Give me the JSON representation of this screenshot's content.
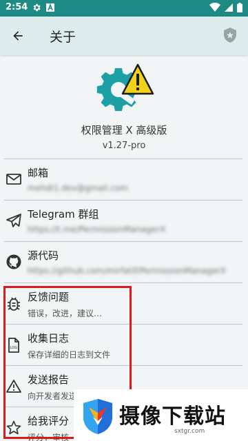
{
  "status_bar": {
    "time": "2:54"
  },
  "app_bar": {
    "title": "关于"
  },
  "header": {
    "app_name": "权限管理 X 高级版",
    "version": "v1.27-pro"
  },
  "items": [
    {
      "title": "邮箱",
      "subtitle": "mehdi1.dev@gmail.com",
      "icon": "mail-icon"
    },
    {
      "title": "Telegram 群组",
      "subtitle": "https://t.me/PermissionManagerX",
      "icon": "telegram-icon"
    },
    {
      "title": "源代码",
      "subtitle": "https://github.com/mirfatif/PermissionManagerX",
      "icon": "github-icon"
    },
    {
      "title": "反馈问题",
      "subtitle": "错误，改进，建议…",
      "icon": "bug-icon"
    },
    {
      "title": "收集日志",
      "subtitle": "保存详细的日志到文件",
      "icon": "log-file-icon"
    },
    {
      "title": "发送报告",
      "subtitle": "向开发者发送崩溃日志",
      "icon": "warning-icon"
    },
    {
      "title": "给我评分",
      "subtitle": "评分，审核",
      "icon": "star-icon"
    }
  ],
  "watermark": {
    "title": "摄像下载站",
    "url": "sxtgr.com"
  },
  "colors": {
    "status_bar": "#1e8a84",
    "app_bar": "#dcecec",
    "background": "#f1f5f5",
    "logo_gear": "#1ca0a6",
    "logo_warning": "#f1d21b",
    "highlight": "#d9191b"
  }
}
